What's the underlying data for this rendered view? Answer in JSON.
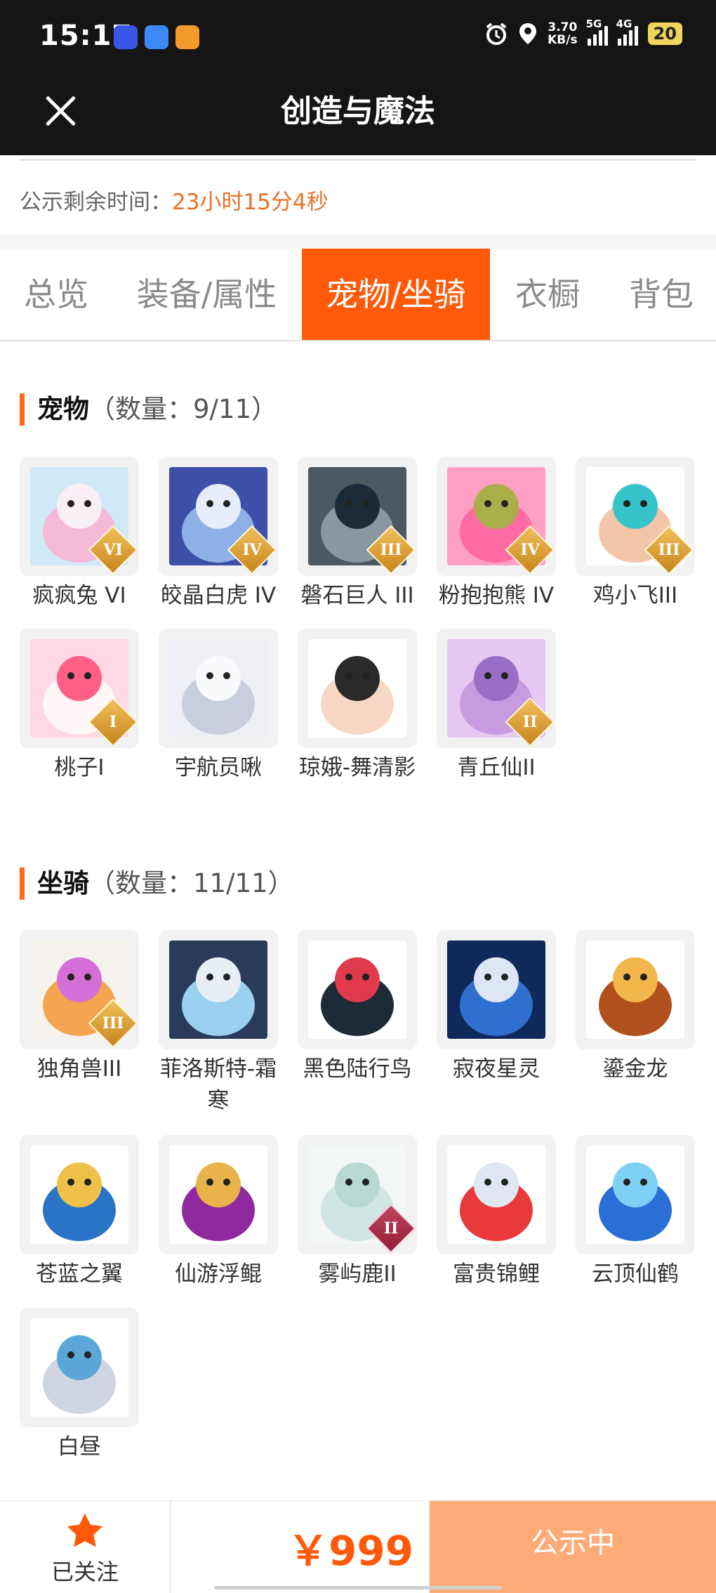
{
  "status_bar": {
    "time": "15:17",
    "speed_value": "3.70",
    "speed_unit": "KB/s",
    "net1": "5G",
    "net2": "4G",
    "battery": "20"
  },
  "header": {
    "title": "创造与魔法"
  },
  "notice": {
    "label": "公示剩余时间：",
    "value": "23小时15分4秒"
  },
  "tabs": [
    {
      "label": "总览",
      "active": false
    },
    {
      "label": "装备/属性",
      "active": false
    },
    {
      "label": "宠物/坐骑",
      "active": true
    },
    {
      "label": "衣橱",
      "active": false
    },
    {
      "label": "背包",
      "active": false
    }
  ],
  "pets": {
    "title": "宠物",
    "count": "（数量：9/11）",
    "items": [
      {
        "name": "疯疯兔 VI",
        "tier": "VI",
        "icon": "pink-rabbit-image",
        "colors": [
          "#cfe9f7",
          "#f6b9d6",
          "#fbeff6"
        ]
      },
      {
        "name": "皎晶白虎 IV",
        "tier": "IV",
        "icon": "white-tiger-image",
        "colors": [
          "#3e4fa8",
          "#8fb0e6",
          "#e6eefc"
        ]
      },
      {
        "name": "磐石巨人 III",
        "tier": "III",
        "icon": "stone-giant-image",
        "colors": [
          "#4d5860",
          "#8a96a0",
          "#1f2a38"
        ]
      },
      {
        "name": "粉抱抱熊 IV",
        "tier": "IV",
        "icon": "pink-bear-image",
        "colors": [
          "#ff9fc3",
          "#ff6aa2",
          "#a9b04a"
        ]
      },
      {
        "name": "鸡小飞III",
        "tier": "III",
        "icon": "bird-costume-image",
        "colors": [
          "#ffffff",
          "#f4c6a8",
          "#36c3c9"
        ]
      },
      {
        "name": "桃子I",
        "tier": "I",
        "icon": "peach-fox-image",
        "colors": [
          "#ffd8e4",
          "#fff6f8",
          "#ff5f86"
        ]
      },
      {
        "name": "宇航员啾",
        "tier": "",
        "icon": "astronaut-image",
        "colors": [
          "#eef0f6",
          "#c9cedc",
          "#f9fafc"
        ]
      },
      {
        "name": "琼娥-舞清影",
        "tier": "",
        "icon": "dancer-girl-image",
        "colors": [
          "#ffffff",
          "#f7d7c4",
          "#2a2a2a"
        ]
      },
      {
        "name": "青丘仙II",
        "tier": "II",
        "icon": "fox-fairy-image",
        "colors": [
          "#e7c8f2",
          "#c79bdf",
          "#9a6ec7"
        ]
      }
    ]
  },
  "mounts": {
    "title": "坐骑",
    "count": "（数量：11/11）",
    "items": [
      {
        "name": "独角兽III",
        "tier": "III",
        "icon": "unicorn-image",
        "colors": [
          "#f6f3ef",
          "#f5a54f",
          "#d36fd6"
        ]
      },
      {
        "name": "菲洛斯特-霜寒",
        "tier": "",
        "icon": "frost-dragon-image",
        "colors": [
          "#2a3b5a",
          "#9ad0f0",
          "#e8eef6"
        ]
      },
      {
        "name": "黑色陆行鸟",
        "tier": "",
        "icon": "black-bird-image",
        "colors": [
          "#ffffff",
          "#1e2a36",
          "#e03a4c"
        ]
      },
      {
        "name": "寂夜星灵",
        "tier": "",
        "icon": "night-wolf-image",
        "colors": [
          "#0f2a5a",
          "#2f6fd0",
          "#dde6f5"
        ]
      },
      {
        "name": "鎏金龙",
        "tier": "",
        "icon": "golden-dragon-image",
        "colors": [
          "#ffffff",
          "#b0501c",
          "#f2b64a"
        ]
      },
      {
        "name": "苍蓝之翼",
        "tier": "",
        "icon": "blue-griffin-image",
        "colors": [
          "#ffffff",
          "#2a74c8",
          "#f0c14a"
        ]
      },
      {
        "name": "仙游浮鲲",
        "tier": "",
        "icon": "flying-fish-image",
        "colors": [
          "#ffffff",
          "#8e2a9e",
          "#e8b34a"
        ]
      },
      {
        "name": "雾屿鹿II",
        "tier": "II",
        "icon": "spirit-deer-image",
        "colors": [
          "#f2f7f6",
          "#cfe6e4",
          "#b8d8d2"
        ]
      },
      {
        "name": "富贵锦鲤",
        "tier": "",
        "icon": "koi-image",
        "colors": [
          "#ffffff",
          "#e83a3a",
          "#dfe8f2"
        ]
      },
      {
        "name": "云顶仙鹤",
        "tier": "",
        "icon": "blue-crane-image",
        "colors": [
          "#ffffff",
          "#2b6fd6",
          "#7ed0f5"
        ]
      },
      {
        "name": "白昼",
        "tier": "",
        "icon": "white-dragon-image",
        "colors": [
          "#ffffff",
          "#cfd6e2",
          "#5aa7d8"
        ]
      }
    ]
  },
  "footer": {
    "follow_label": "已关注",
    "price": "￥999",
    "status_label": "公示中",
    "accent": "#ff5a0a"
  }
}
